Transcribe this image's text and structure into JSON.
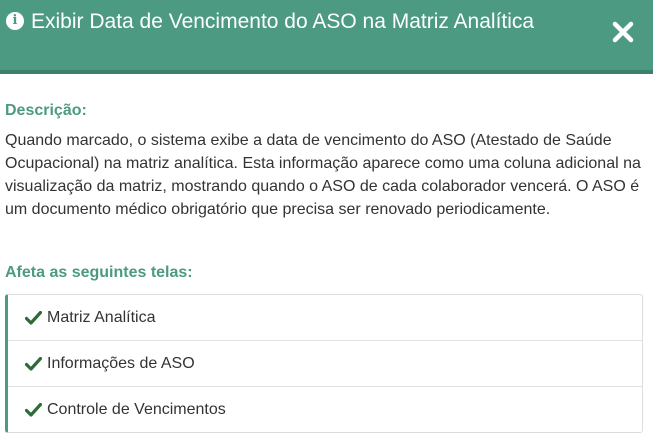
{
  "header": {
    "title": "Exibir Data de Vencimento do ASO na Matriz Analítica",
    "info_icon": "info-circle-icon",
    "close_icon": "close-icon",
    "info_glyph": "i",
    "background_color": "#4c9a82"
  },
  "description": {
    "label": "Descrição:",
    "text": "Quando marcado, o sistema exibe a data de vencimento do ASO (Atestado de Saúde Ocupacional) na matriz analítica. Esta informação aparece como uma coluna adicional na visualização da matriz, mostrando quando o ASO de cada colaborador vencerá. O ASO é um documento médico obrigatório que precisa ser renovado periodicamente."
  },
  "affected_screens": {
    "label": "Afeta as seguintes telas:",
    "item_icon": "check-icon",
    "items": [
      {
        "label": "Matriz Analítica"
      },
      {
        "label": "Informações de ASO"
      },
      {
        "label": "Controle de Vencimentos"
      }
    ]
  },
  "colors": {
    "accent": "#4c9a82",
    "check": "#2f6b3a",
    "text": "#333333"
  }
}
